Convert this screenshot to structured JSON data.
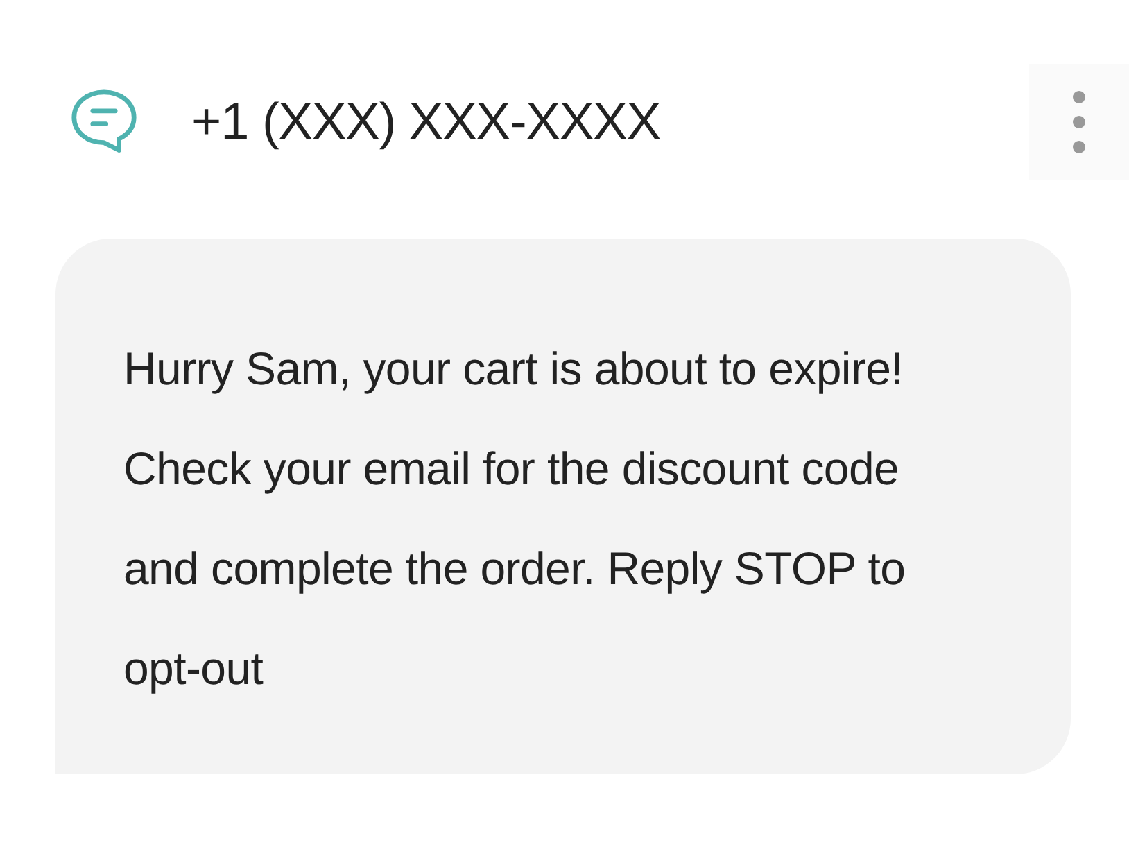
{
  "header": {
    "phone": "+1 (XXX) XXX-XXXX"
  },
  "message": {
    "text": "Hurry Sam, your cart is about to expire! Check your email for the discount code and complete the order. Reply STOP to opt-out"
  }
}
